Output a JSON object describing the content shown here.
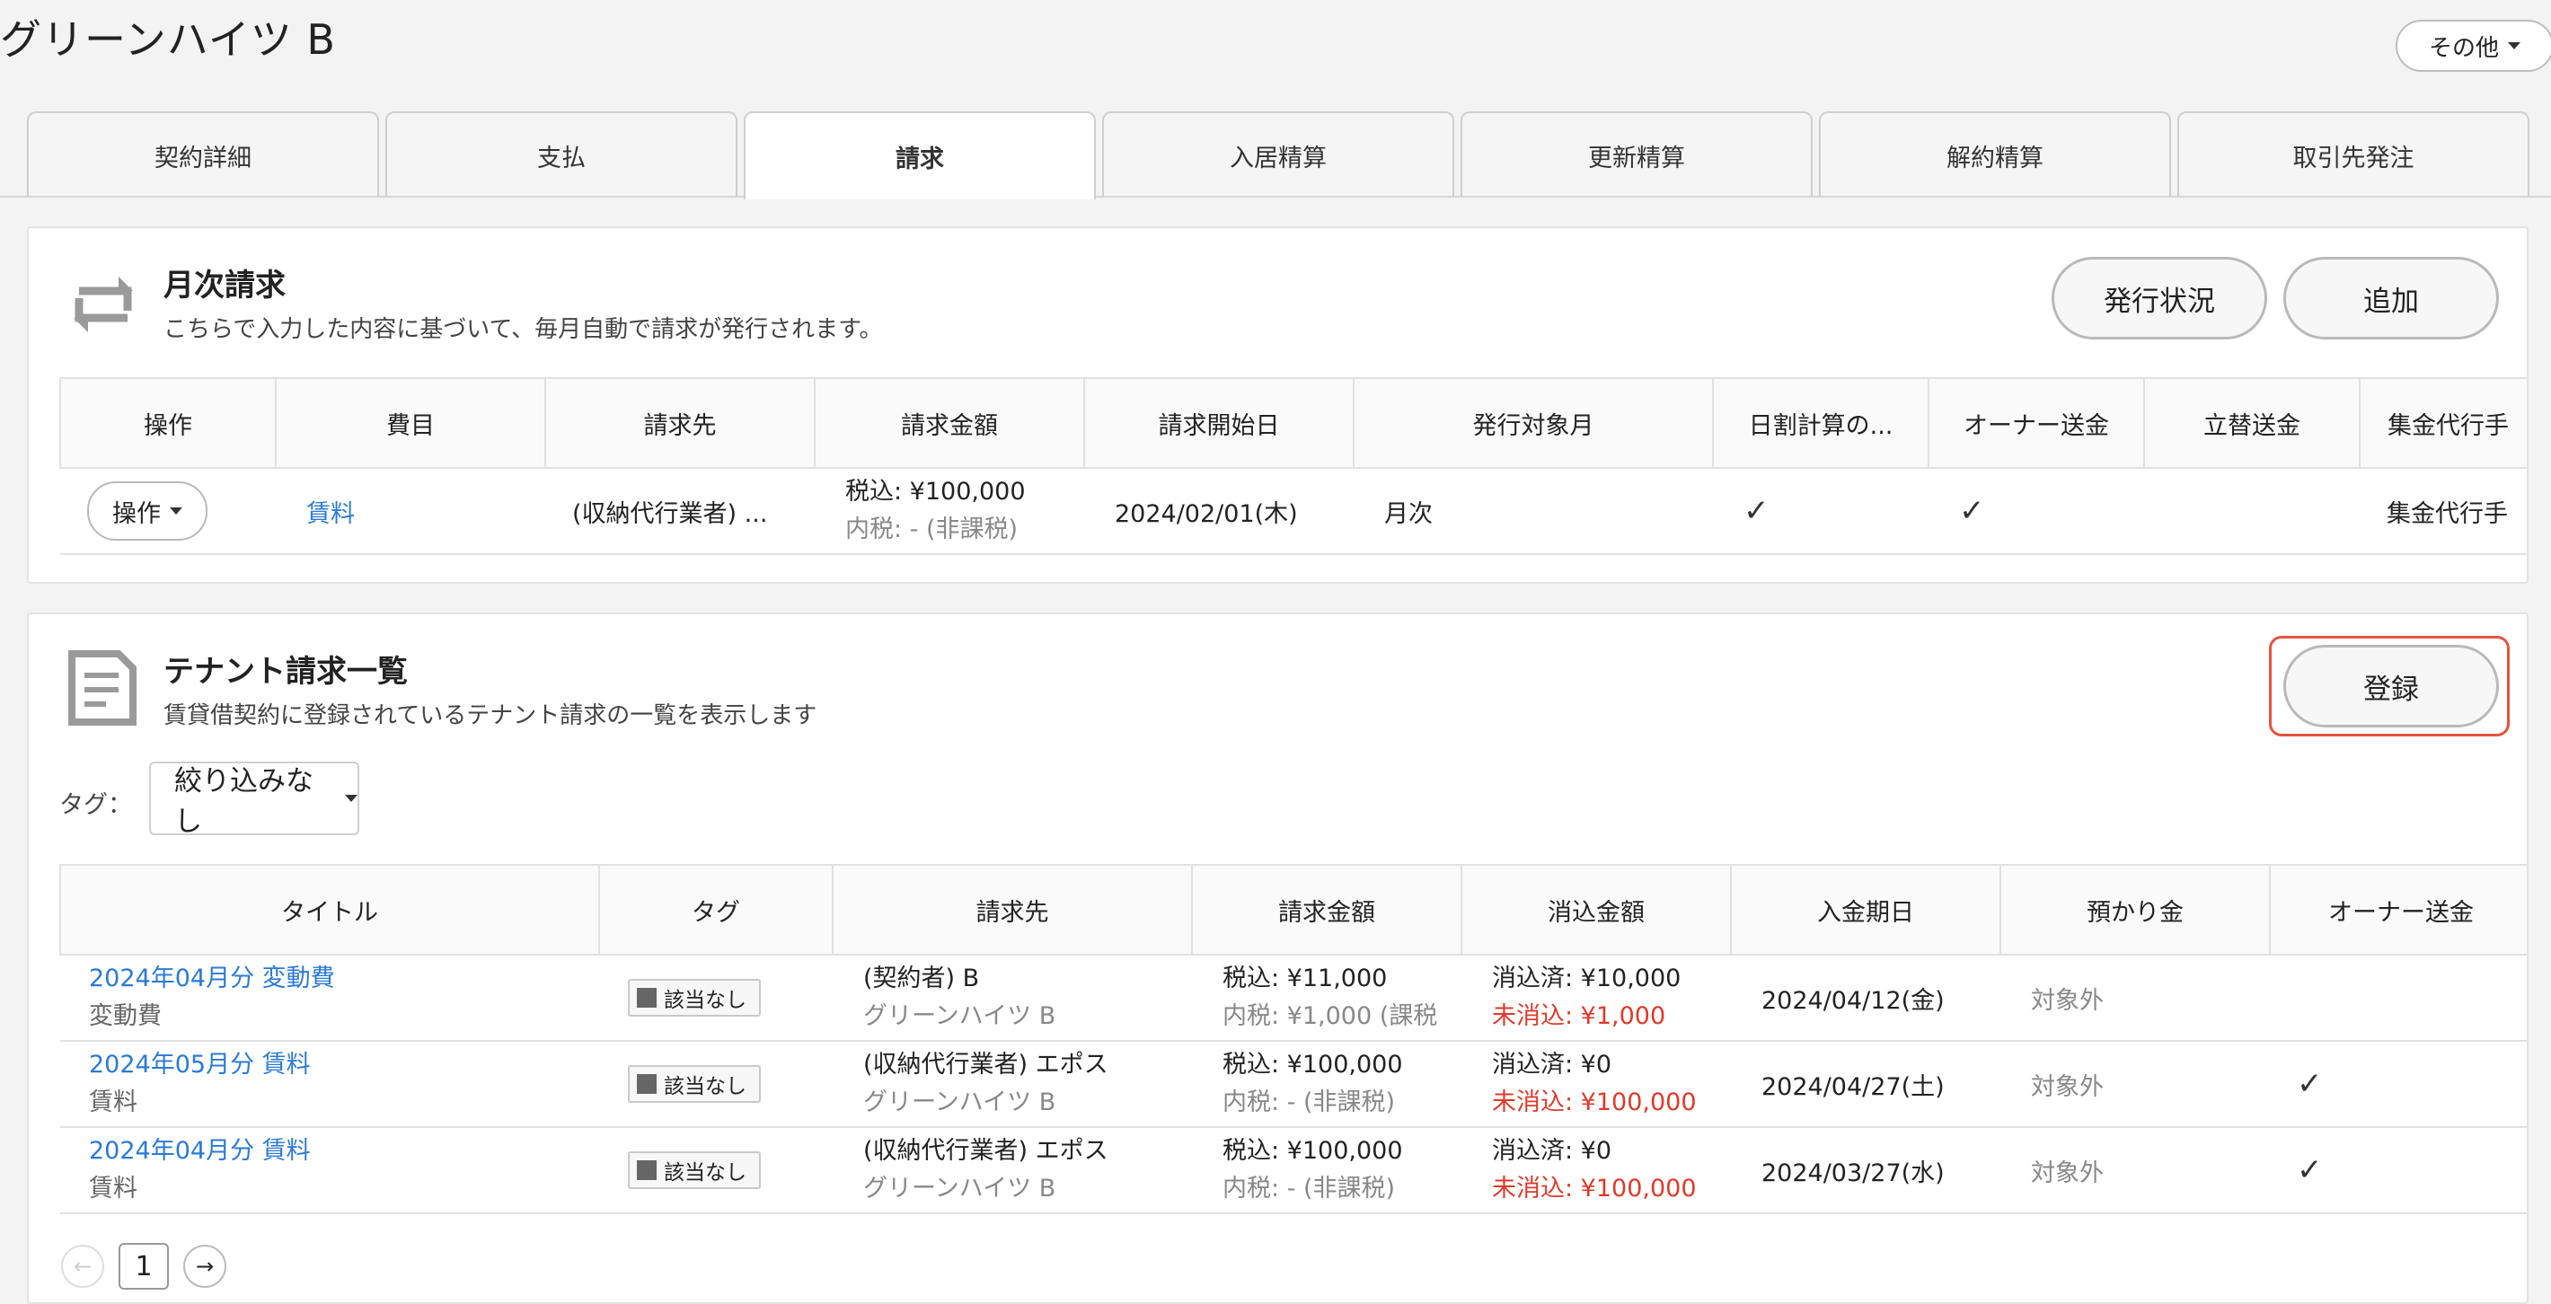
{
  "page_title": "グリーンハイツ B",
  "more_button": "その他",
  "tabs": [
    "契約詳細",
    "支払",
    "請求",
    "入居精算",
    "更新精算",
    "解約精算",
    "取引先発注"
  ],
  "active_tab": "請求",
  "monthly": {
    "title": "月次請求",
    "description": "こちらで入力した内容に基づいて、毎月自動で請求が発行されます。",
    "status_button": "発行状況",
    "add_button": "追加",
    "columns": [
      "操作",
      "費目",
      "請求先",
      "請求金額",
      "請求開始日",
      "発行対象月",
      "日割計算の...",
      "オーナー送金",
      "立替送金",
      "集金代行手"
    ],
    "rows": [
      {
        "op": "操作",
        "item": "賃料",
        "billed_to": "(収納代行業者) ...",
        "amount_main": "税込: ¥100,000",
        "amount_sub": "内税: - (非課税)",
        "start_date": "2024/02/01(木)",
        "target_month": "月次",
        "prorate": "✓",
        "owner_remit": "✓",
        "advance_remit": "",
        "collection_agent": "集金代行手"
      }
    ]
  },
  "tenant": {
    "title": "テナント請求一覧",
    "description": "賃貸借契約に登録されているテナント請求の一覧を表示します",
    "register_button": "登録",
    "tag_label": "タグ：",
    "tag_filter": "絞り込みなし",
    "columns": [
      "タイトル",
      "タグ",
      "請求先",
      "請求金額",
      "消込金額",
      "入金期日",
      "預かり金",
      "オーナー送金"
    ],
    "rows": [
      {
        "title": "2024年04月分 変動費",
        "subtitle": "変動費",
        "tag": "該当なし",
        "billed_to": "(契約者) B",
        "billed_to_sub": "グリーンハイツ B",
        "amount_main": "税込: ¥11,000",
        "amount_sub": "内税: ¥1,000 (課税",
        "cleared": "消込済: ¥10,000",
        "uncleared": "未消込: ¥1,000",
        "due_date": "2024/04/12(金)",
        "deposit": "対象外",
        "owner_remit": ""
      },
      {
        "title": "2024年05月分 賃料",
        "subtitle": "賃料",
        "tag": "該当なし",
        "billed_to": "(収納代行業者) エポス",
        "billed_to_sub": "グリーンハイツ B",
        "amount_main": "税込: ¥100,000",
        "amount_sub": "内税: - (非課税)",
        "cleared": "消込済: ¥0",
        "uncleared": "未消込: ¥100,000",
        "due_date": "2024/04/27(土)",
        "deposit": "対象外",
        "owner_remit": "✓"
      },
      {
        "title": "2024年04月分 賃料",
        "subtitle": "賃料",
        "tag": "該当なし",
        "billed_to": "(収納代行業者) エポス",
        "billed_to_sub": "グリーンハイツ B",
        "amount_main": "税込: ¥100,000",
        "amount_sub": "内税: - (非課税)",
        "cleared": "消込済: ¥0",
        "uncleared": "未消込: ¥100,000",
        "due_date": "2024/03/27(水)",
        "deposit": "対象外",
        "owner_remit": "✓"
      }
    ],
    "pager": {
      "prev": "←",
      "current": "1",
      "next": "→"
    }
  },
  "colors": {
    "link": "#2b7ad6",
    "danger": "#e0392a",
    "highlight": "#e5533d"
  }
}
